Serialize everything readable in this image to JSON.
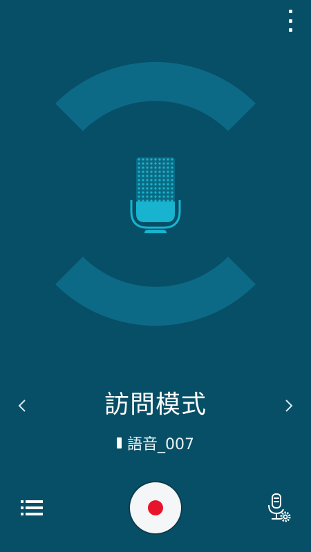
{
  "toolbar": {
    "more_icon": "more-vertical-icon"
  },
  "recorder": {
    "mode_title": "訪問模式",
    "file_name": "語音_007",
    "icons": {
      "microphone": "microphone-icon",
      "prev": "chevron-left-icon",
      "next": "chevron-right-icon",
      "list": "list-icon",
      "record": "record-icon",
      "settings": "microphone-settings-icon"
    },
    "colors": {
      "background": "#074f66",
      "arc": "#0c6a87",
      "mic": "#17b3cf",
      "record_dot": "#e8142a"
    }
  }
}
